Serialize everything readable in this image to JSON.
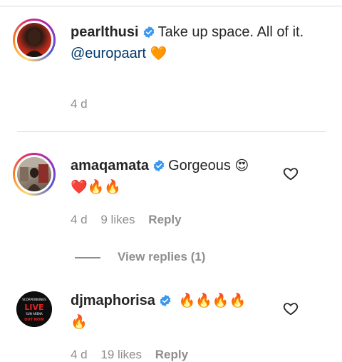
{
  "comments": [
    {
      "username": "pearlthusi",
      "verified": true,
      "text": "Take up space. All of it.",
      "mention": "@europaart",
      "emoji": "🧡",
      "time": "4 d"
    },
    {
      "username": "amaqamata",
      "verified": true,
      "text": "Gorgeous",
      "emoji_inline": "😍",
      "emoji_line": "❤️🔥🔥",
      "time": "4 d",
      "likes": "9 likes",
      "reply_label": "Reply"
    },
    {
      "username": "djmaphorisa",
      "verified": true,
      "emoji_inline": "🔥🔥🔥🔥",
      "emoji_line": "🔥",
      "time": "4 d",
      "likes": "19 likes",
      "reply_label": "Reply",
      "avatar_text": {
        "top": "SCORPIONKINGS",
        "main": "LIVE",
        "sub": "SUN ARENA",
        "bottom": "OUT NOW"
      }
    }
  ],
  "view_replies": "View replies (1)",
  "icons": {
    "verified": "verified-badge-icon",
    "like": "heart-outline-icon"
  },
  "colors": {
    "verified_blue": "#3897f0",
    "mention_blue": "#00376b",
    "meta_gray": "#8e8e8e"
  }
}
